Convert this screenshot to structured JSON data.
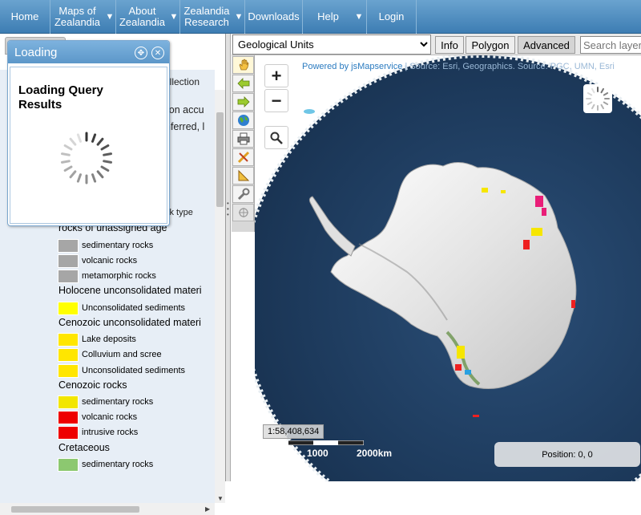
{
  "nav": {
    "home": "Home",
    "maps_of_zealandia": [
      "Maps of",
      "Zealandia"
    ],
    "about_zealandia": [
      "About",
      "Zealandia"
    ],
    "zealandia_research": [
      "Zealandia",
      "Research"
    ],
    "downloads": "Downloads",
    "help": "Help",
    "login": "Login",
    "dropdown_arrow": "▼"
  },
  "loading_dialog": {
    "title": "Loading",
    "message": "Loading Query Results"
  },
  "legend": {
    "partial_text": [
      "ollection",
      "ion accu",
      "nferred, l",
      "ck type"
    ],
    "sections": [
      {
        "heading": "rocks of unassigned age",
        "items": [
          {
            "label": "sedimentary rocks",
            "color": "#a6a6a6"
          },
          {
            "label": "volcanic rocks",
            "color": "#a6a6a6"
          },
          {
            "label": "metamorphic rocks",
            "color": "#a6a6a6"
          }
        ]
      },
      {
        "heading": "Holocene unconsolidated materi",
        "items": [
          {
            "label": "Unconsolidated sediments",
            "color": "#ffff00"
          }
        ]
      },
      {
        "heading": "Cenozoic unconsolidated materi",
        "items": [
          {
            "label": "Lake deposits",
            "color": "#ffe600"
          },
          {
            "label": "Colluvium and scree",
            "color": "#ffe600"
          },
          {
            "label": "Unconsolidated sediments",
            "color": "#ffe600"
          }
        ]
      },
      {
        "heading": "Cenozoic rocks",
        "items": [
          {
            "label": "sedimentary rocks",
            "color": "#f2e600"
          },
          {
            "label": "volcanic rocks",
            "color": "#ee0000"
          },
          {
            "label": "intrusive rocks",
            "color": "#ee0000"
          }
        ]
      },
      {
        "heading": "Cretaceous",
        "items": [
          {
            "label": "sedimentary rocks",
            "color": "#8cc870"
          }
        ]
      }
    ]
  },
  "toolbar": {
    "layer_selected": "Geological Units",
    "info": "Info",
    "polygon": "Polygon",
    "advanced": "Advanced",
    "search_placeholder": "Search layers"
  },
  "map": {
    "attribution_powered": "Powered by jsMapservice",
    "attribution_rest": " | Source: Esri, Geographics. Source: PGC, UMN, Esri",
    "zoom_in": "+",
    "zoom_out": "−",
    "scale": "1:58,408,634",
    "scale_labels": [
      "0",
      "1000",
      "2000km"
    ],
    "position": "Position: 0, 0"
  }
}
